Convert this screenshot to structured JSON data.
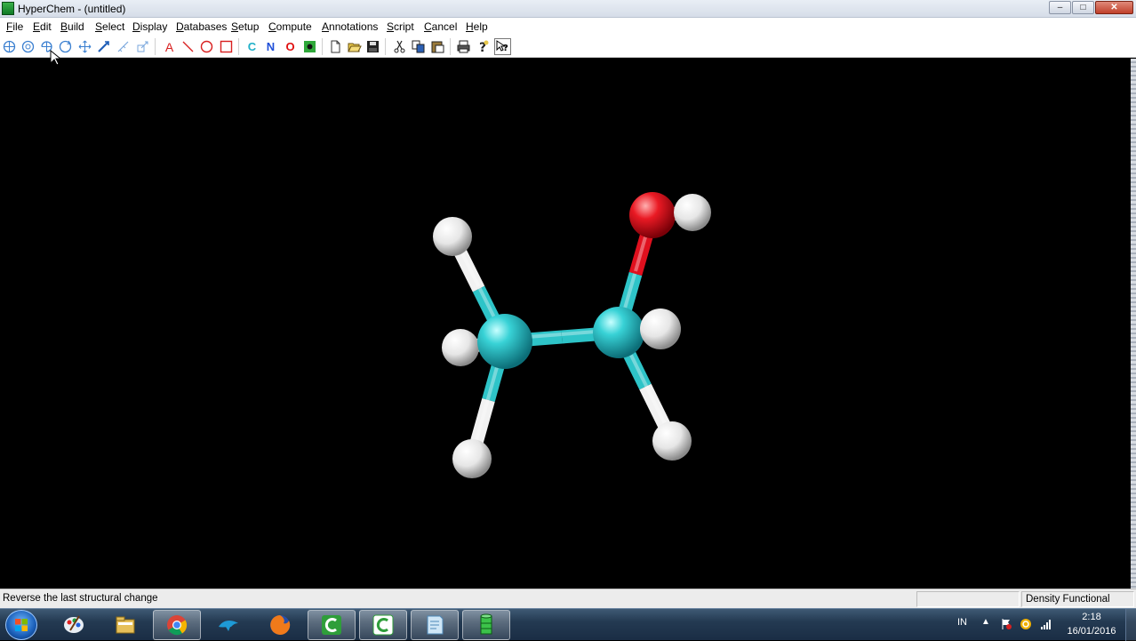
{
  "window": {
    "title": "HyperChem - (untitled)",
    "controls": {
      "minimize": "–",
      "maximize": "□",
      "close": "✕"
    }
  },
  "menu": [
    "File",
    "Edit",
    "Build",
    "Select",
    "Display",
    "Databases",
    "Setup",
    "Compute",
    "Annotations",
    "Script",
    "Cancel",
    "Help"
  ],
  "toolbar": {
    "tools": [
      {
        "name": "draw-tool-icon",
        "glyph": ""
      },
      {
        "name": "select-tool-icon",
        "glyph": ""
      },
      {
        "name": "xy-rotate-icon",
        "glyph": ""
      },
      {
        "name": "z-rotate-icon",
        "glyph": ""
      },
      {
        "name": "xy-translate-icon",
        "glyph": ""
      },
      {
        "name": "z-translate-icon",
        "glyph": ""
      },
      {
        "name": "zoom-icon",
        "glyph": ""
      },
      {
        "name": "z-clip-icon",
        "glyph": ""
      }
    ],
    "annotations": [
      {
        "name": "text-annotation-icon",
        "glyph": "A"
      },
      {
        "name": "line-annotation-icon",
        "glyph": ""
      },
      {
        "name": "ellipse-annotation-icon",
        "glyph": ""
      },
      {
        "name": "rectangle-annotation-icon",
        "glyph": ""
      }
    ],
    "elements": [
      {
        "symbol": "C",
        "color": "#20b0c8"
      },
      {
        "symbol": "N",
        "color": "#1f4fd8"
      },
      {
        "symbol": "O",
        "color": "#e01010"
      }
    ]
  },
  "molecule": {
    "atoms": [
      {
        "id": "C1",
        "element": "C"
      },
      {
        "id": "C2",
        "element": "C"
      },
      {
        "id": "O1",
        "element": "O"
      },
      {
        "id": "H1",
        "element": "H"
      },
      {
        "id": "H2",
        "element": "H"
      },
      {
        "id": "H3",
        "element": "H"
      },
      {
        "id": "H4",
        "element": "H"
      },
      {
        "id": "H5",
        "element": "H"
      },
      {
        "id": "H6",
        "element": "H"
      }
    ],
    "colors": {
      "C": "#2ec4c8",
      "O": "#e0101e",
      "H": "#f2f2f2"
    }
  },
  "status": {
    "message": "Reverse the last structural change",
    "method": "Density Functional"
  },
  "taskbar": {
    "apps": [
      "paint-icon",
      "explorer-icon",
      "chrome-icon",
      "dolphin-icon",
      "firefox-icon",
      "camtasia-icon",
      "camtasia-recorder-icon",
      "notepad-icon",
      "hyperchem-icon"
    ],
    "tray_lang": "IN",
    "tray_up": "▲",
    "time": "2:18",
    "date": "16/01/2016"
  }
}
